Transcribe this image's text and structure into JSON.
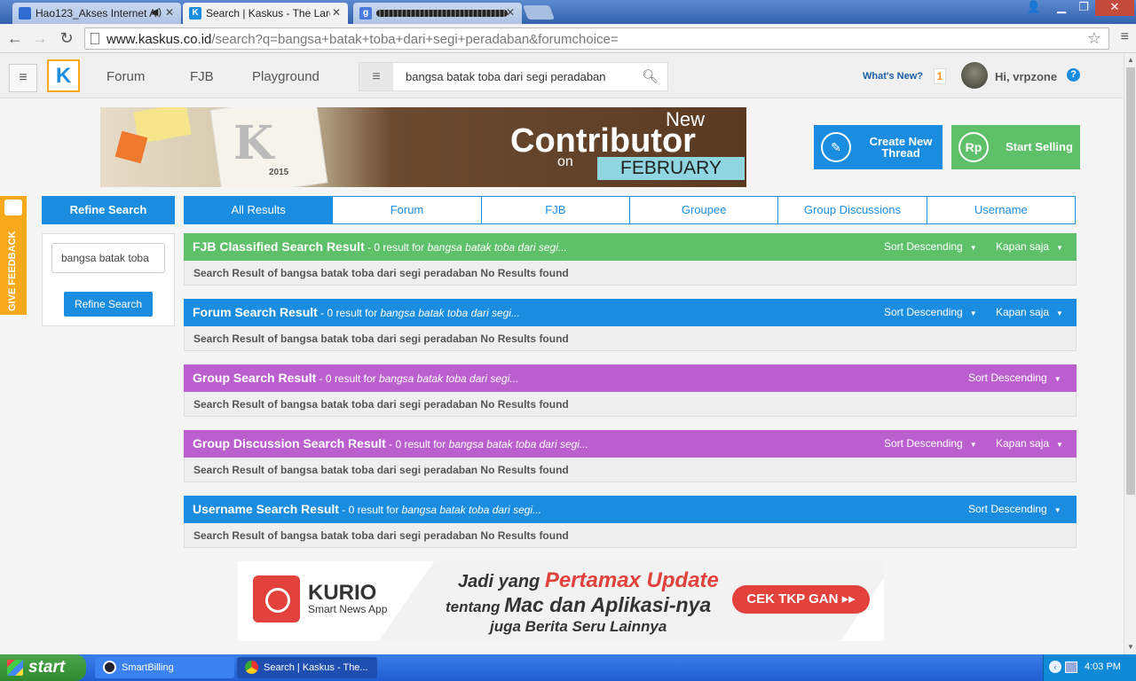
{
  "browser": {
    "tabs": [
      {
        "title": "Hao123_Akses Internet A",
        "fav_color": "#2f6bd0",
        "active": false
      },
      {
        "title": "Search | Kaskus - The Larges",
        "fav_color": "#1a8de0",
        "active": true
      },
      {
        "title": "",
        "fav_color": "#4a7ae0",
        "active": false
      }
    ],
    "url_host": "www.kaskus.co.id",
    "url_rest": "/search?q=bangsa+batak+toba+dari+segi+peradaban&forumchoice="
  },
  "header": {
    "logo": "K",
    "nav": [
      "Forum",
      "FJB",
      "Playground"
    ],
    "search_value": "bangsa batak toba dari segi peradaban",
    "whats_new": "What's New?",
    "notif_count": "1",
    "greeting": "Hi, vrpzone",
    "help": "?"
  },
  "banner": {
    "new": "New",
    "contributor": "Contributor",
    "on": "on",
    "month": "FEBRUARY",
    "year": "2015"
  },
  "actions": {
    "create_line1": "Create New",
    "create_line2": "Thread",
    "sell": "Start Selling",
    "rp": "Rp"
  },
  "feedback": "GIVE FEEDBACK",
  "sidebar": {
    "heading": "Refine Search",
    "input_value": "bangsa batak toba",
    "button": "Refine Search"
  },
  "search_tabs": [
    "All Results",
    "Forum",
    "FJB",
    "Groupee",
    "Group Discussions",
    "Username"
  ],
  "sections": [
    {
      "title": "FJB Classified Search Result",
      "count_text": " - 0 result for ",
      "query": "bangsa batak toba dari segi...",
      "sort": "Sort Descending",
      "kapan": "Kapan saja",
      "color": "#5ec16a",
      "body": "Search Result of bangsa batak toba dari segi peradaban No Results found"
    },
    {
      "title": "Forum Search Result",
      "count_text": " - 0 result for ",
      "query": "bangsa batak toba dari segi...",
      "sort": "Sort Descending",
      "kapan": "Kapan saja",
      "color": "#1a8de0",
      "body": "Search Result of bangsa batak toba dari segi peradaban No Results found"
    },
    {
      "title": "Group Search Result",
      "count_text": " - 0 result for ",
      "query": "bangsa batak toba dari segi...",
      "sort": "Sort Descending",
      "kapan": "",
      "color": "#bb5fcf",
      "body": "Search Result of bangsa batak toba dari segi peradaban No Results found"
    },
    {
      "title": "Group Discussion Search Result",
      "count_text": " - 0 result for ",
      "query": "bangsa batak toba dari segi...",
      "sort": "Sort Descending",
      "kapan": "Kapan saja",
      "color": "#bb5fcf",
      "body": "Search Result of bangsa batak toba dari segi peradaban No Results found"
    },
    {
      "title": "Username Search Result",
      "count_text": " - 0 result for ",
      "query": "bangsa batak toba dari segi...",
      "sort": "Sort Descending",
      "kapan": "",
      "color": "#1a8de0",
      "body": "Search Result of bangsa batak toba dari segi peradaban No Results found"
    }
  ],
  "ad": {
    "brand": "KURIO",
    "brand_sub": "Smart News App",
    "line1_pre": "Jadi yang ",
    "line1_hl": "Pertamax Update",
    "line2_pre": "tentang ",
    "line2_hl": "Mac dan Aplikasi-nya",
    "line3": "juga Berita Seru Lainnya",
    "cta": "CEK TKP GAN ▸▸"
  },
  "taskbar": {
    "start": "start",
    "tasks": [
      "SmartBilling",
      "Search | Kaskus - The..."
    ],
    "clock": "4:03 PM"
  }
}
